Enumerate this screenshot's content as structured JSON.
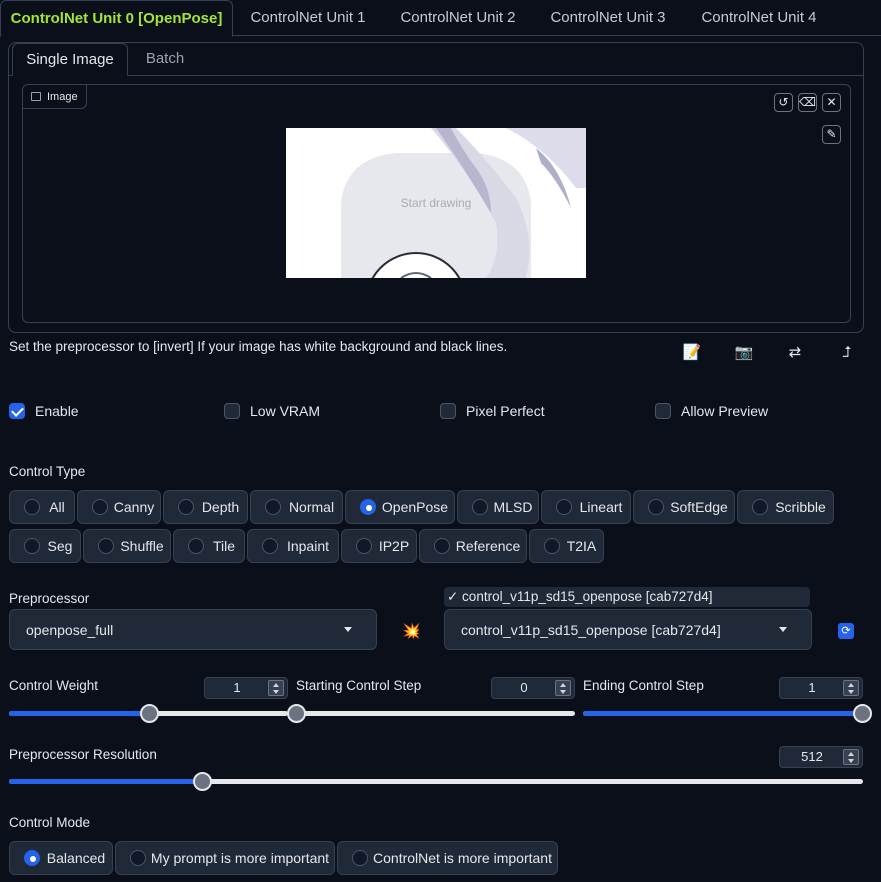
{
  "unit_tabs": [
    "ControlNet Unit 0 [OpenPose]",
    "ControlNet Unit 1",
    "ControlNet Unit 2",
    "ControlNet Unit 3",
    "ControlNet Unit 4"
  ],
  "active_unit_tab": 0,
  "image_tabs": [
    "Single Image",
    "Batch"
  ],
  "active_image_tab": 0,
  "image_panel": {
    "label": "Image",
    "canvas_hint": "Start drawing",
    "icons": [
      "undo-icon",
      "eraser-icon",
      "close-icon",
      "brush-icon"
    ]
  },
  "hint": "Set the preprocessor to [invert] If your image has white background and black lines.",
  "tool_icons": [
    "notepad-icon",
    "camera-icon",
    "swap-icon",
    "send-icon"
  ],
  "checkboxes": [
    {
      "label": "Enable",
      "checked": true
    },
    {
      "label": "Low VRAM",
      "checked": false
    },
    {
      "label": "Pixel Perfect",
      "checked": false
    },
    {
      "label": "Allow Preview",
      "checked": false
    }
  ],
  "control_type": {
    "label": "Control Type",
    "options": [
      "All",
      "Canny",
      "Depth",
      "Normal",
      "OpenPose",
      "MLSD",
      "Lineart",
      "SoftEdge",
      "Scribble",
      "Seg",
      "Shuffle",
      "Tile",
      "Inpaint",
      "IP2P",
      "Reference",
      "T2IA"
    ],
    "selected": "OpenPose"
  },
  "preprocessor": {
    "label": "Preprocessor",
    "value": "openpose_full"
  },
  "model": {
    "banner": "✓ control_v11p_sd15_openpose [cab727d4]",
    "value": "control_v11p_sd15_openpose [cab727d4]"
  },
  "sliders": {
    "control_weight": {
      "label": "Control Weight",
      "value": "1",
      "min": 0,
      "max": 2,
      "current": 1
    },
    "starting_step": {
      "label": "Starting Control Step",
      "value": "0",
      "min": 0,
      "max": 1,
      "current": 0
    },
    "ending_step": {
      "label": "Ending Control Step",
      "value": "1",
      "min": 0,
      "max": 1,
      "current": 1
    },
    "preprocessor_resolution": {
      "label": "Preprocessor Resolution",
      "value": "512",
      "min": 64,
      "max": 2048,
      "current": 512
    }
  },
  "control_mode": {
    "label": "Control Mode",
    "options": [
      "Balanced",
      "My prompt is more important",
      "ControlNet is more important"
    ],
    "selected": "Balanced"
  },
  "colors": {
    "accent": "#2563eb",
    "active_tab_text": "#a3e635",
    "background": "#0b0f19"
  }
}
